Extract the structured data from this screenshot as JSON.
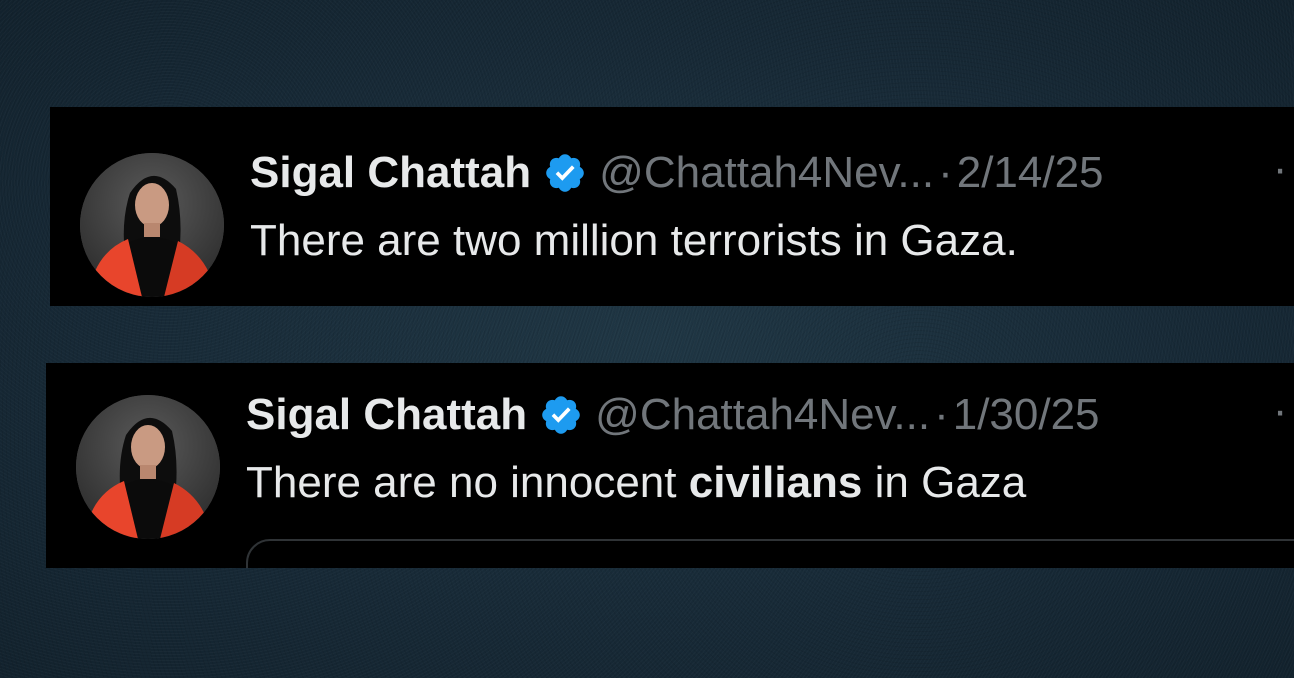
{
  "tweets": [
    {
      "author_name": "Sigal Chattah",
      "handle": "@Chattah4Nev...",
      "separator": "·",
      "date": "2/14/25",
      "more_label": "··",
      "text_before": "There are two million terrorists in Gaza.",
      "text_bold": "",
      "text_after": ""
    },
    {
      "author_name": "Sigal Chattah",
      "handle": "@Chattah4Nev...",
      "separator": "·",
      "date": "1/30/25",
      "more_label": "··",
      "text_before": "There are no innocent ",
      "text_bold": "civilians",
      "text_after": " in Gaza"
    }
  ],
  "colors": {
    "background": "#172936",
    "tweet_background": "#000000",
    "primary_text": "#e7e9ea",
    "secondary_text": "#71767b",
    "verified_badge": "#1d9bf0",
    "avatar_jacket": "#e8452c"
  },
  "icons": {
    "verified": "verified-badge-icon",
    "more": "more-options-icon"
  }
}
